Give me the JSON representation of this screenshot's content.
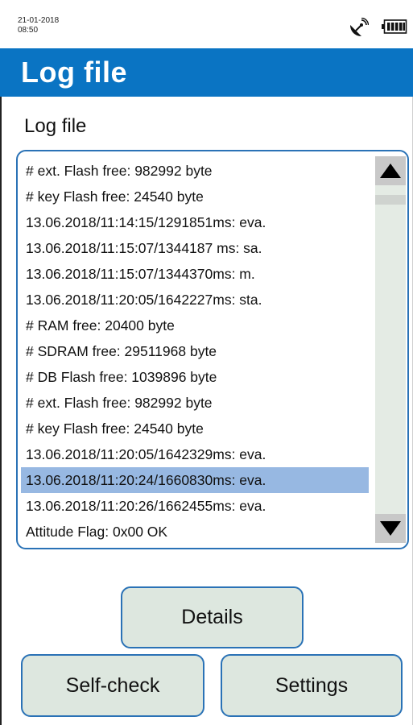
{
  "status": {
    "date": "21-01-2018",
    "time": "08:50",
    "icons": [
      "satellite-icon",
      "battery-icon"
    ]
  },
  "header": {
    "title": "Log file"
  },
  "section": {
    "label": "Log file"
  },
  "log": {
    "entries": [
      "# ext. Flash free: 982992 byte",
      "# key Flash free: 24540 byte",
      "13.06.2018/11:14:15/1291851ms: eva.",
      "13.06.2018/11:15:07/1344187 ms: sa.",
      "13.06.2018/11:15:07/1344370ms: m.",
      "13.06.2018/11:20:05/1642227ms: sta.",
      "# RAM free: 20400 byte",
      "# SDRAM free: 29511968 byte",
      "# DB Flash free: 1039896 byte",
      "# ext. Flash free: 982992 byte",
      "# key Flash free: 24540 byte",
      "13.06.2018/11:20:05/1642329ms: eva.",
      "13.06.2018/11:20:24/1660830ms: eva.",
      "13.06.2018/11:20:26/1662455ms: eva.",
      "Attitude Flag: 0x00 OK"
    ],
    "selected_index": 12
  },
  "buttons": {
    "details": "Details",
    "self_check": "Self-check",
    "settings": "Settings"
  },
  "colors": {
    "title_bar": "#0a74c3",
    "border": "#2a72b6",
    "button_bg": "#dde7df",
    "selection": "#97b8e2"
  }
}
